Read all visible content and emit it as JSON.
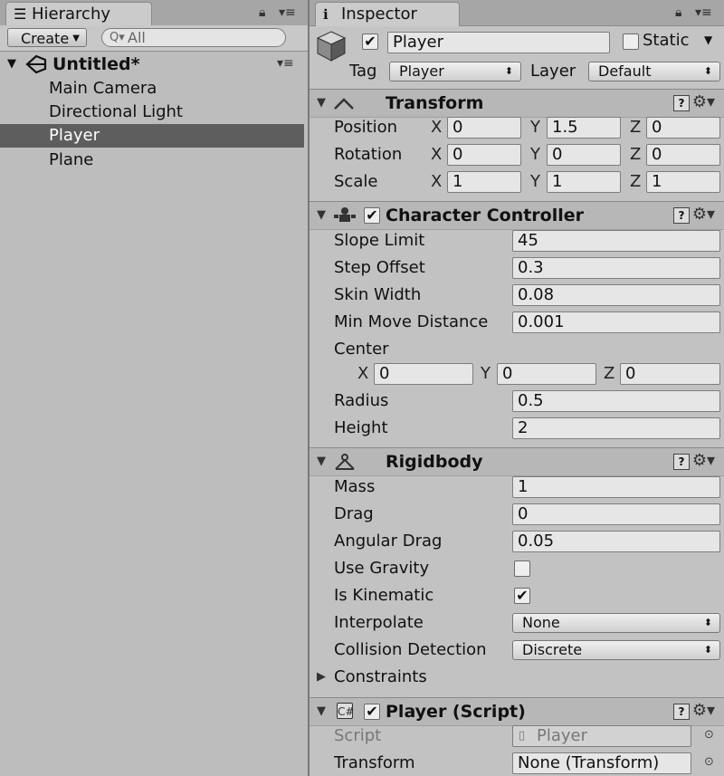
{
  "hierarchy": {
    "tab_label": "Hierarchy",
    "create_label": "Create",
    "search_placeholder": "All",
    "scene_name": "Untitled*",
    "items": [
      {
        "label": "Main Camera",
        "selected": false
      },
      {
        "label": "Directional Light",
        "selected": false
      },
      {
        "label": "Player",
        "selected": true
      },
      {
        "label": "Plane",
        "selected": false
      }
    ]
  },
  "inspector": {
    "tab_label": "Inspector",
    "object": {
      "active": true,
      "name": "Player",
      "static_label": "Static",
      "static": false,
      "tag_label": "Tag",
      "tag": "Player",
      "layer_label": "Layer",
      "layer": "Default"
    },
    "transform": {
      "title": "Transform",
      "position_label": "Position",
      "rotation_label": "Rotation",
      "scale_label": "Scale",
      "axes": {
        "x": "X",
        "y": "Y",
        "z": "Z"
      },
      "position": {
        "x": "0",
        "y": "1.5",
        "z": "0"
      },
      "rotation": {
        "x": "0",
        "y": "0",
        "z": "0"
      },
      "scale": {
        "x": "1",
        "y": "1",
        "z": "1"
      }
    },
    "character_controller": {
      "title": "Character Controller",
      "enabled": true,
      "slope_limit_label": "Slope Limit",
      "slope_limit": "45",
      "step_offset_label": "Step Offset",
      "step_offset": "0.3",
      "skin_width_label": "Skin Width",
      "skin_width": "0.08",
      "min_move_label": "Min Move Distance",
      "min_move": "0.001",
      "center_label": "Center",
      "center": {
        "x": "0",
        "y": "0",
        "z": "0"
      },
      "radius_label": "Radius",
      "radius": "0.5",
      "height_label": "Height",
      "height": "2"
    },
    "rigidbody": {
      "title": "Rigidbody",
      "mass_label": "Mass",
      "mass": "1",
      "drag_label": "Drag",
      "drag": "0",
      "angular_drag_label": "Angular Drag",
      "angular_drag": "0.05",
      "use_gravity_label": "Use Gravity",
      "use_gravity": false,
      "is_kinematic_label": "Is Kinematic",
      "is_kinematic": true,
      "interpolate_label": "Interpolate",
      "interpolate": "None",
      "collision_label": "Collision Detection",
      "collision": "Discrete",
      "constraints_label": "Constraints"
    },
    "player_script": {
      "title": "Player (Script)",
      "enabled": true,
      "script_label": "Script",
      "script": "Player",
      "transform_label": "Transform",
      "transform": "None (Transform)"
    }
  },
  "icons": {
    "hierarchy_tab": "list-icon",
    "inspector_tab": "info-icon",
    "lock": "lock-icon",
    "menu": "menu-icon",
    "help": "help-icon",
    "gear": "gear-icon"
  },
  "colors": {
    "selection": "#5e5e5e",
    "panel": "#c2c2c2"
  }
}
